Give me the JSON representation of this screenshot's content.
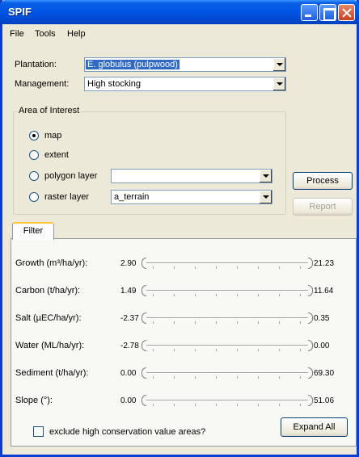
{
  "window": {
    "title": "SPIF"
  },
  "menu": [
    "File",
    "Tools",
    "Help"
  ],
  "plantation": {
    "label": "Plantation:",
    "value": "E. globulus (pulpwood)"
  },
  "management": {
    "label": "Management:",
    "value": "High stocking"
  },
  "area": {
    "title": "Area of Interest",
    "options": [
      {
        "label": "map",
        "checked": true
      },
      {
        "label": "extent",
        "checked": false
      },
      {
        "label": "polygon layer",
        "checked": false
      },
      {
        "label": "raster layer",
        "checked": false
      }
    ],
    "polygon_value": "",
    "raster_value": "a_terrain"
  },
  "buttons": {
    "process": "Process",
    "report": "Report",
    "expand_all": "Expand All"
  },
  "filter": {
    "tab": "Filter",
    "rows": [
      {
        "label": "Growth (m³/ha/yr):",
        "min": "2.90",
        "max": "21.23"
      },
      {
        "label": "Carbon (t/ha/yr):",
        "min": "1.49",
        "max": "11.64"
      },
      {
        "label": "Salt (µEC/ha/yr):",
        "min": "-2.37",
        "max": "0.35"
      },
      {
        "label": "Water (ML/ha/yr):",
        "min": "-2.78",
        "max": "0.00"
      },
      {
        "label": "Sediment (t/ha/yr):",
        "min": "0.00",
        "max": "69.30"
      },
      {
        "label": "Slope (°):",
        "min": "0.00",
        "max": "51.06"
      }
    ],
    "exclude_label": "exclude high conservation value areas?"
  }
}
